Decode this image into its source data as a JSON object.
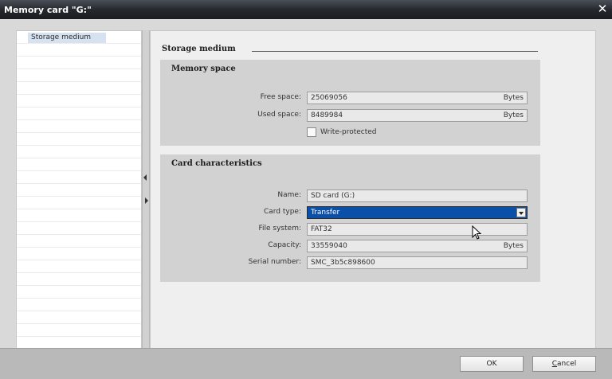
{
  "window": {
    "title": "Memory card \"G:\"",
    "close_glyph": "✕"
  },
  "nav": {
    "items": [
      {
        "label": "Storage medium"
      }
    ]
  },
  "content": {
    "heading": "Storage medium",
    "memory_space": {
      "title": "Memory space",
      "free_space": {
        "label": "Free space:",
        "value": "25069056",
        "unit": "Bytes"
      },
      "used_space": {
        "label": "Used space:",
        "value": "8489984",
        "unit": "Bytes"
      },
      "write_protected": {
        "label": "Write-protected",
        "checked": false
      }
    },
    "card_characteristics": {
      "title": "Card characteristics",
      "name": {
        "label": "Name:",
        "value": "SD card (G:)"
      },
      "card_type": {
        "label": "Card type:",
        "value": "Transfer"
      },
      "file_system": {
        "label": "File system:",
        "value": "FAT32"
      },
      "capacity": {
        "label": "Capacity:",
        "value": "33559040",
        "unit": "Bytes"
      },
      "serial_number": {
        "label": "Serial number:",
        "value": "SMC_3b5c898600"
      }
    }
  },
  "footer": {
    "ok_label": "OK",
    "cancel_prefix": "C",
    "cancel_rest": "ancel"
  },
  "colors": {
    "selection": "#0a4fa8",
    "titlebar": "#23262b",
    "panel": "#d2d2d2"
  }
}
